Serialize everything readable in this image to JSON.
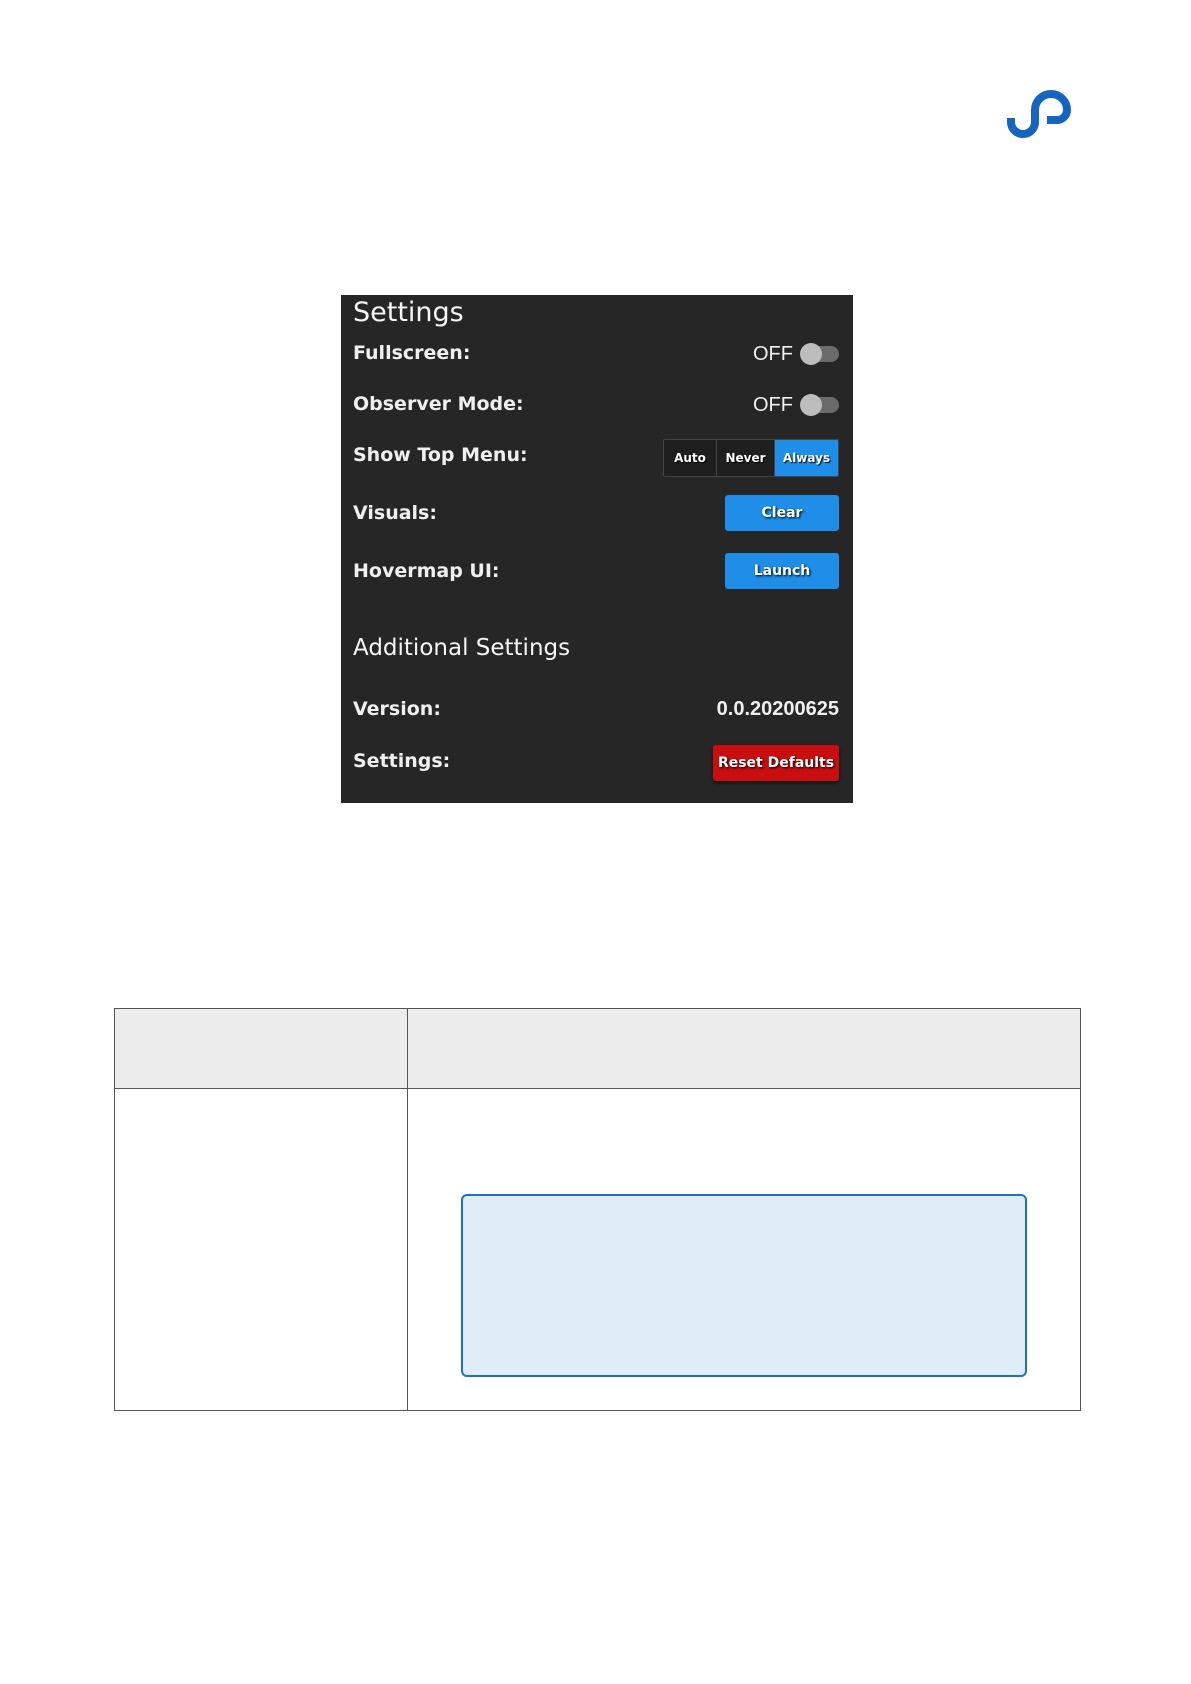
{
  "logo": {
    "icon": "brand-logo-icon",
    "color": "#1565c0"
  },
  "settings": {
    "title": "Settings",
    "fullscreen": {
      "label": "Fullscreen:",
      "state": "OFF"
    },
    "observer_mode": {
      "label": "Observer Mode:",
      "state": "OFF"
    },
    "show_top_menu": {
      "label": "Show Top Menu:",
      "options": [
        "Auto",
        "Never",
        "Always"
      ],
      "selected": "Always"
    },
    "visuals": {
      "label": "Visuals:",
      "button": "Clear"
    },
    "hovermap_ui": {
      "label": "Hovermap UI:",
      "button": "Launch"
    },
    "additional": {
      "title": "Additional Settings",
      "version": {
        "label": "Version:",
        "value": "0.0.20200625"
      },
      "reset": {
        "label": "Settings:",
        "button": "Reset Defaults"
      }
    }
  },
  "colors": {
    "panel_bg": "#262626",
    "accent_blue": "#1e8ee9",
    "danger_red": "#c80e0e",
    "note_bg": "#e1ecf9",
    "note_border": "#1f6fc4"
  }
}
